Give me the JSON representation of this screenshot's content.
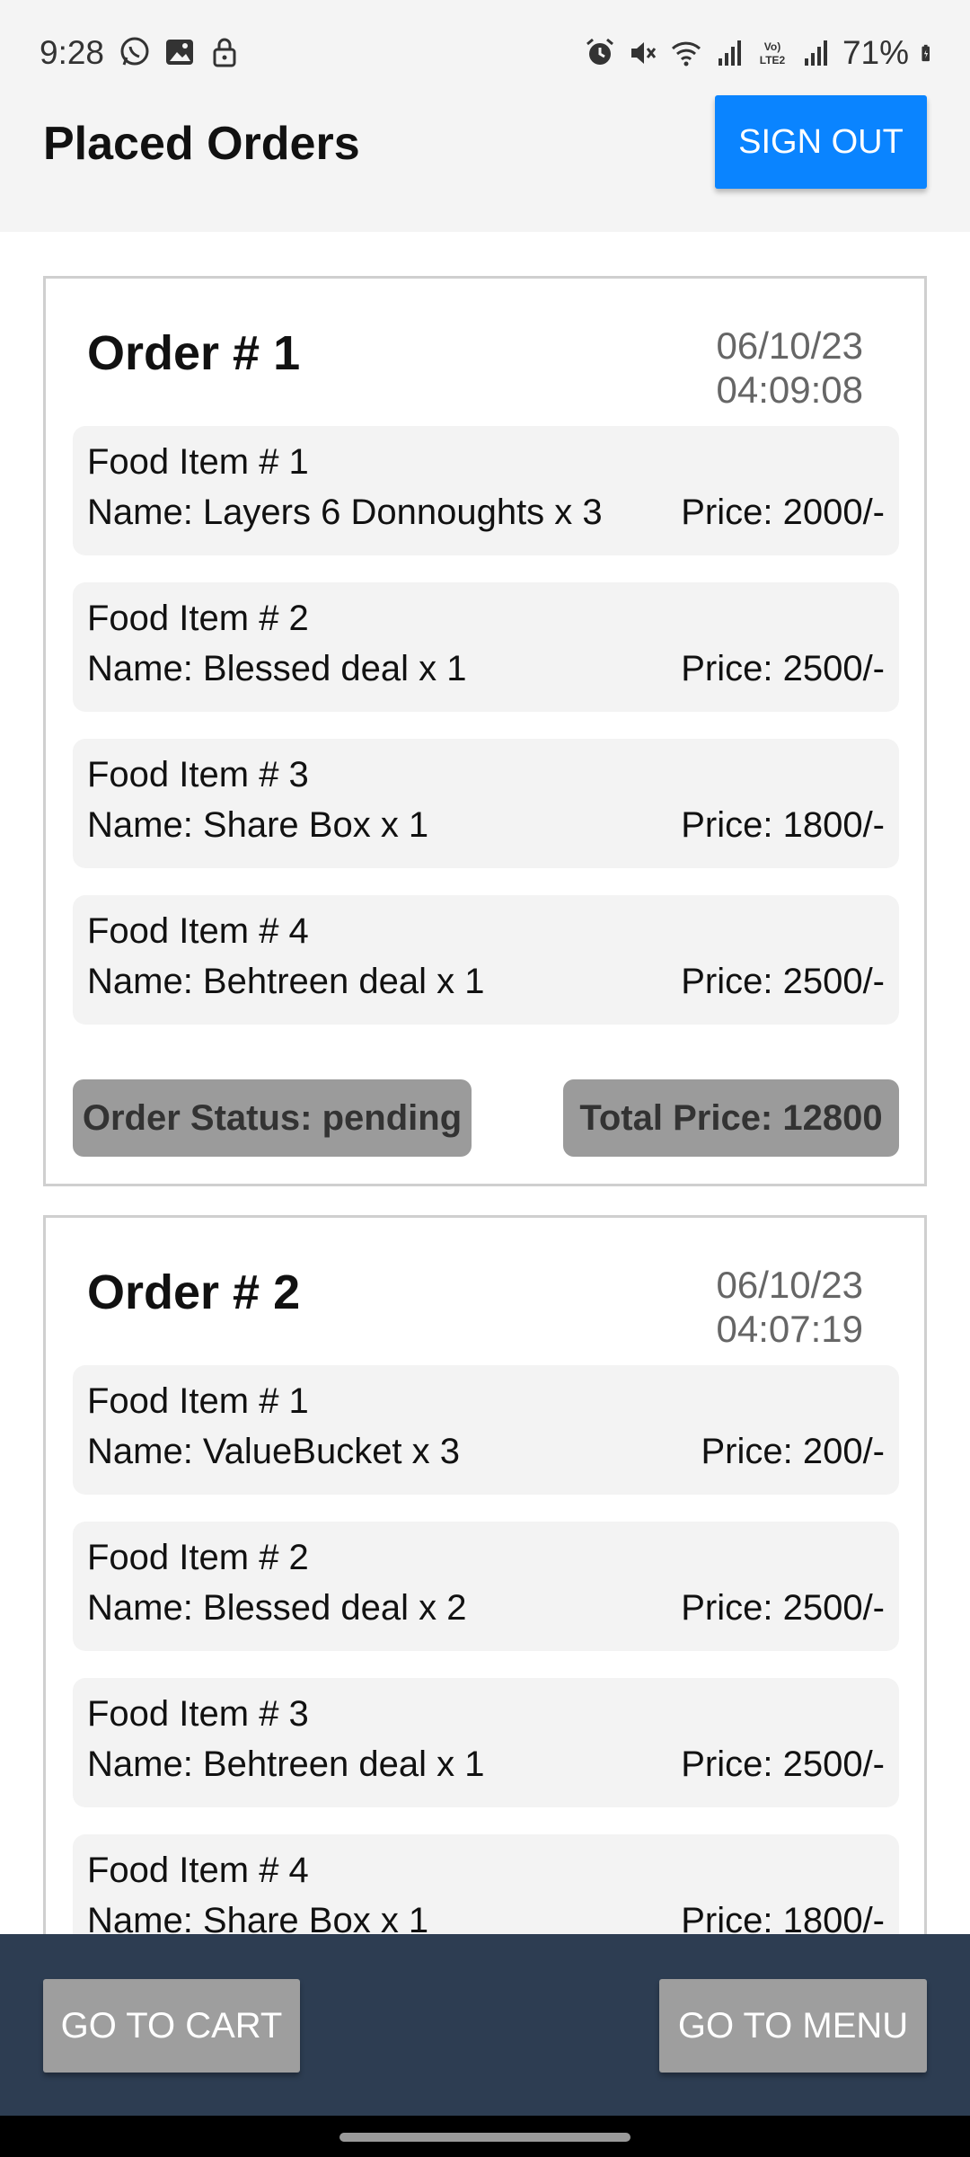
{
  "status_bar": {
    "time": "9:28",
    "battery_percent": "71%",
    "left_icons": [
      "whatsapp-icon",
      "gallery-icon",
      "lock-icon"
    ],
    "right_icons": [
      "alarm-icon",
      "mute-icon",
      "wifi-icon",
      "signal-icon",
      "volte-icon",
      "signal-icon",
      "battery-icon"
    ]
  },
  "header": {
    "title": "Placed Orders",
    "signout_label": "SIGN OUT"
  },
  "orders": [
    {
      "title": "Order # 1",
      "date": "06/10/23",
      "time": "04:09:08",
      "items": [
        {
          "number": "Food Item # 1",
          "name": "Name: Layers 6 Donnoughts x 3",
          "price": "Price: 2000/-"
        },
        {
          "number": "Food Item # 2",
          "name": "Name: Blessed deal x 1",
          "price": "Price: 2500/-"
        },
        {
          "number": "Food Item # 3",
          "name": "Name: Share Box x 1",
          "price": "Price: 1800/-"
        },
        {
          "number": "Food Item # 4",
          "name": "Name: Behtreen deal x 1",
          "price": "Price: 2500/-"
        }
      ],
      "status": "Order Status: pending",
      "total": "Total Price: 12800"
    },
    {
      "title": "Order # 2",
      "date": "06/10/23",
      "time": "04:07:19",
      "items": [
        {
          "number": "Food Item # 1",
          "name": "Name: ValueBucket x 3",
          "price": "Price: 200/-"
        },
        {
          "number": "Food Item # 2",
          "name": "Name: Blessed deal x 2",
          "price": "Price: 2500/-"
        },
        {
          "number": "Food Item # 3",
          "name": "Name: Behtreen deal x 1",
          "price": "Price: 2500/-"
        },
        {
          "number": "Food Item # 4",
          "name": "Name: Share Box x 1",
          "price": "Price: 1800/-"
        }
      ]
    }
  ],
  "bottom_bar": {
    "cart_label": "GO TO CART",
    "menu_label": "GO TO MENU"
  },
  "colors": {
    "accent": "#0a84ff",
    "bottom_bar": "#2d3d52",
    "badge": "#9b9b9b"
  }
}
